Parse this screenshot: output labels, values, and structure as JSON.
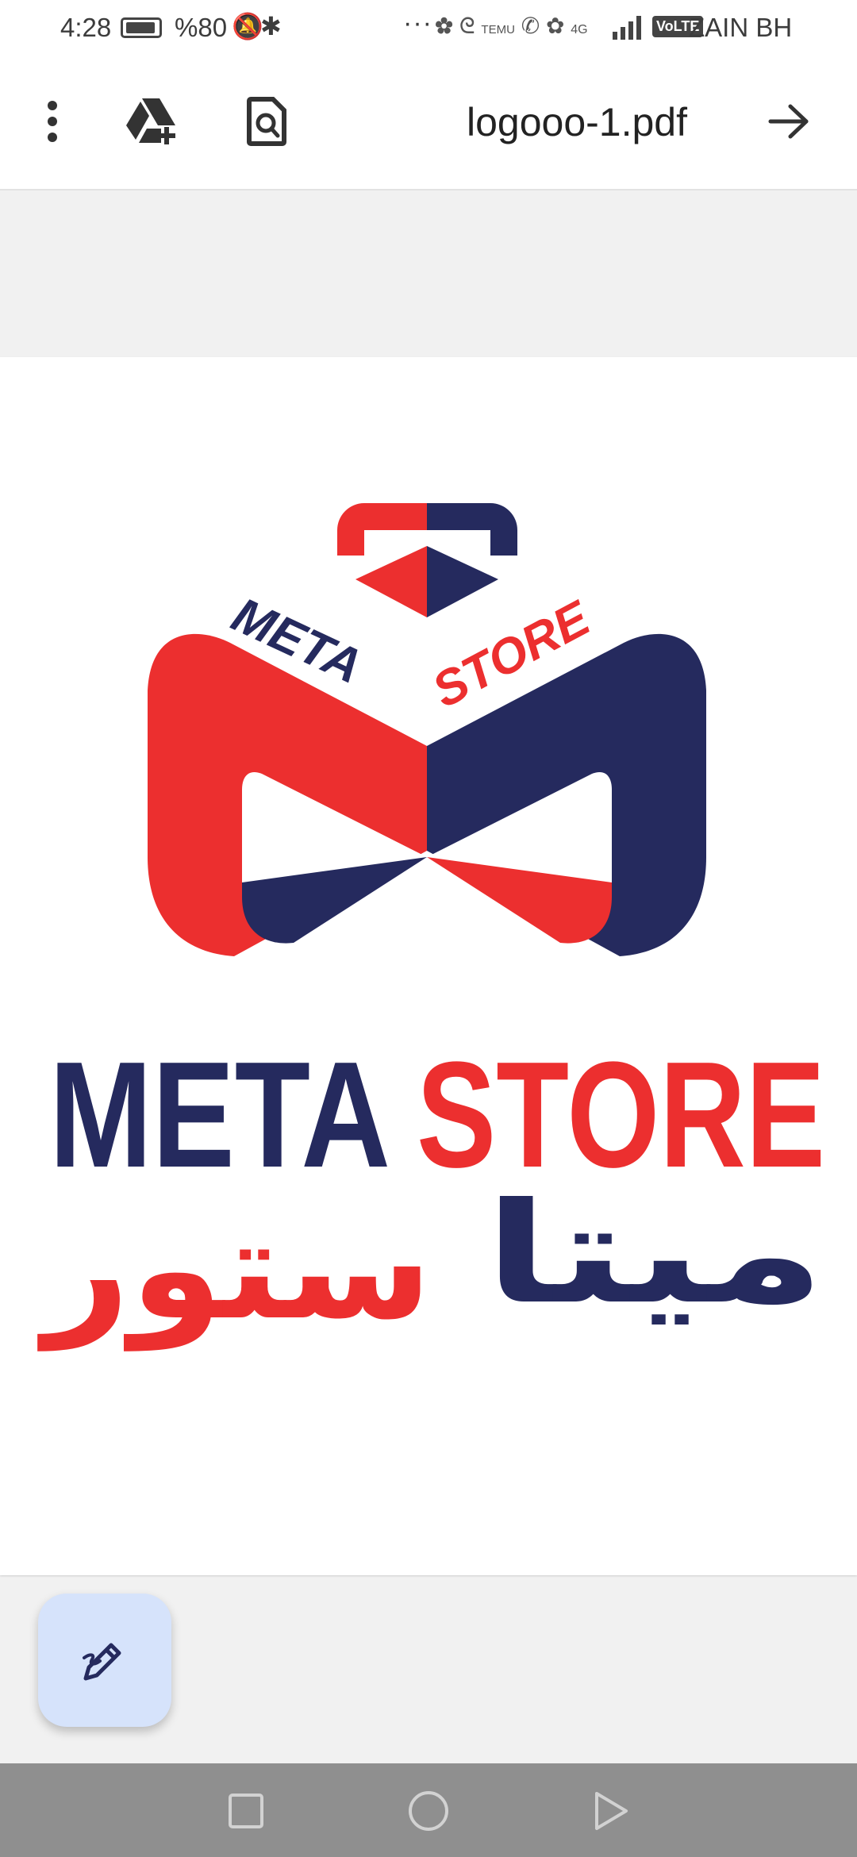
{
  "status_bar": {
    "time": "4:28",
    "battery": "%80",
    "carrier": "ZAIN BH",
    "volte": "VoLTE",
    "network": "4G",
    "notif_app": "TEMU"
  },
  "toolbar": {
    "file_name": "logooo-1.pdf",
    "icons": [
      "more-vert-icon",
      "add-to-drive-icon",
      "find-in-page-icon",
      "arrow-forward-icon"
    ]
  },
  "document": {
    "logo_ribbon_left": "META",
    "logo_ribbon_right": "STORE",
    "title_left": "META",
    "title_right": "STORE",
    "arabic_left": "ستور",
    "arabic_right": "ميتا"
  },
  "fab": {
    "icon": "edit-pen-icon"
  },
  "nav": {
    "icons": [
      "recents-square-icon",
      "home-circle-icon",
      "back-triangle-icon"
    ]
  },
  "colors": {
    "brand_red": "#ec2f2f",
    "brand_navy": "#252a5e",
    "fab_bg": "#d6e3fb"
  }
}
